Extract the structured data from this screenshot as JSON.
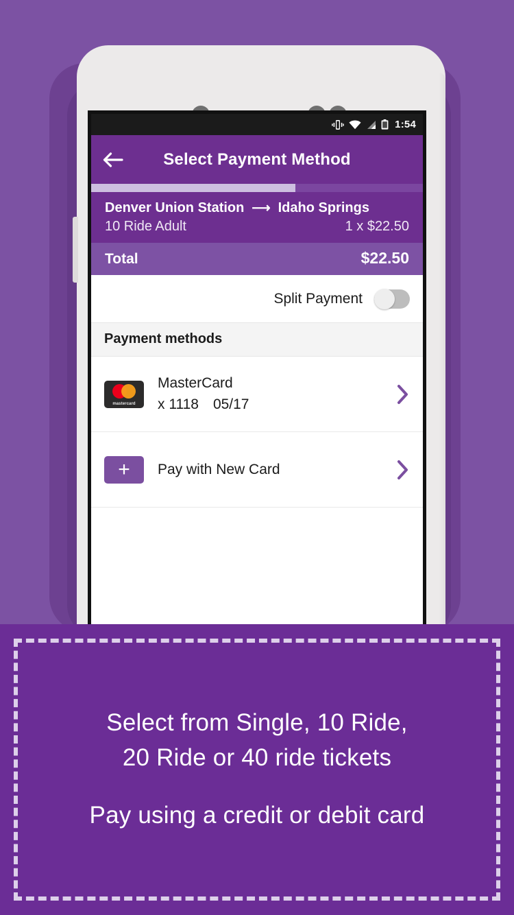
{
  "theme": {
    "background_purple": "#7c52a3",
    "appbar_purple": "#6d2f90",
    "total_purple": "#7d52a4",
    "caption_purple": "#6b2d96",
    "accent_purple": "#7b4fa0",
    "progress_fill": "#cdbfe0",
    "mastercard_red": "#eb001b",
    "mastercard_orange": "#f79e1b"
  },
  "statusbar": {
    "vibrate_icon": "vibrate-icon",
    "wifi_icon": "wifi-icon",
    "signal_icon": "cell-signal-icon",
    "battery_icon": "battery-icon",
    "time": "1:54"
  },
  "appbar": {
    "back_icon": "back-arrow-icon",
    "title": "Select Payment Method"
  },
  "progress": {
    "percent": 61.5
  },
  "trip": {
    "origin": "Denver Union Station",
    "arrow_icon": "arrow-right-icon",
    "destination": "Idaho Springs",
    "fare_type": "10 Ride Adult",
    "quantity_price": "1 x $22.50",
    "total_label": "Total",
    "total_value": "$22.50"
  },
  "split_payment": {
    "label": "Split Payment",
    "state": "off"
  },
  "payment_methods": {
    "section_title": "Payment methods",
    "items": [
      {
        "icon": "mastercard-logo-icon",
        "brand_word": "mastercard",
        "title": "MasterCard",
        "number": "x 1118",
        "expiry": "05/17",
        "chevron_icon": "chevron-right-icon"
      },
      {
        "icon": "plus-card-icon",
        "title": "Pay with New Card",
        "chevron_icon": "chevron-right-icon"
      }
    ]
  },
  "caption": {
    "line1": "Select from Single, 10 Ride,",
    "line2": "20 Ride or 40 ride tickets",
    "line3": "Pay using a credit or debit card"
  }
}
